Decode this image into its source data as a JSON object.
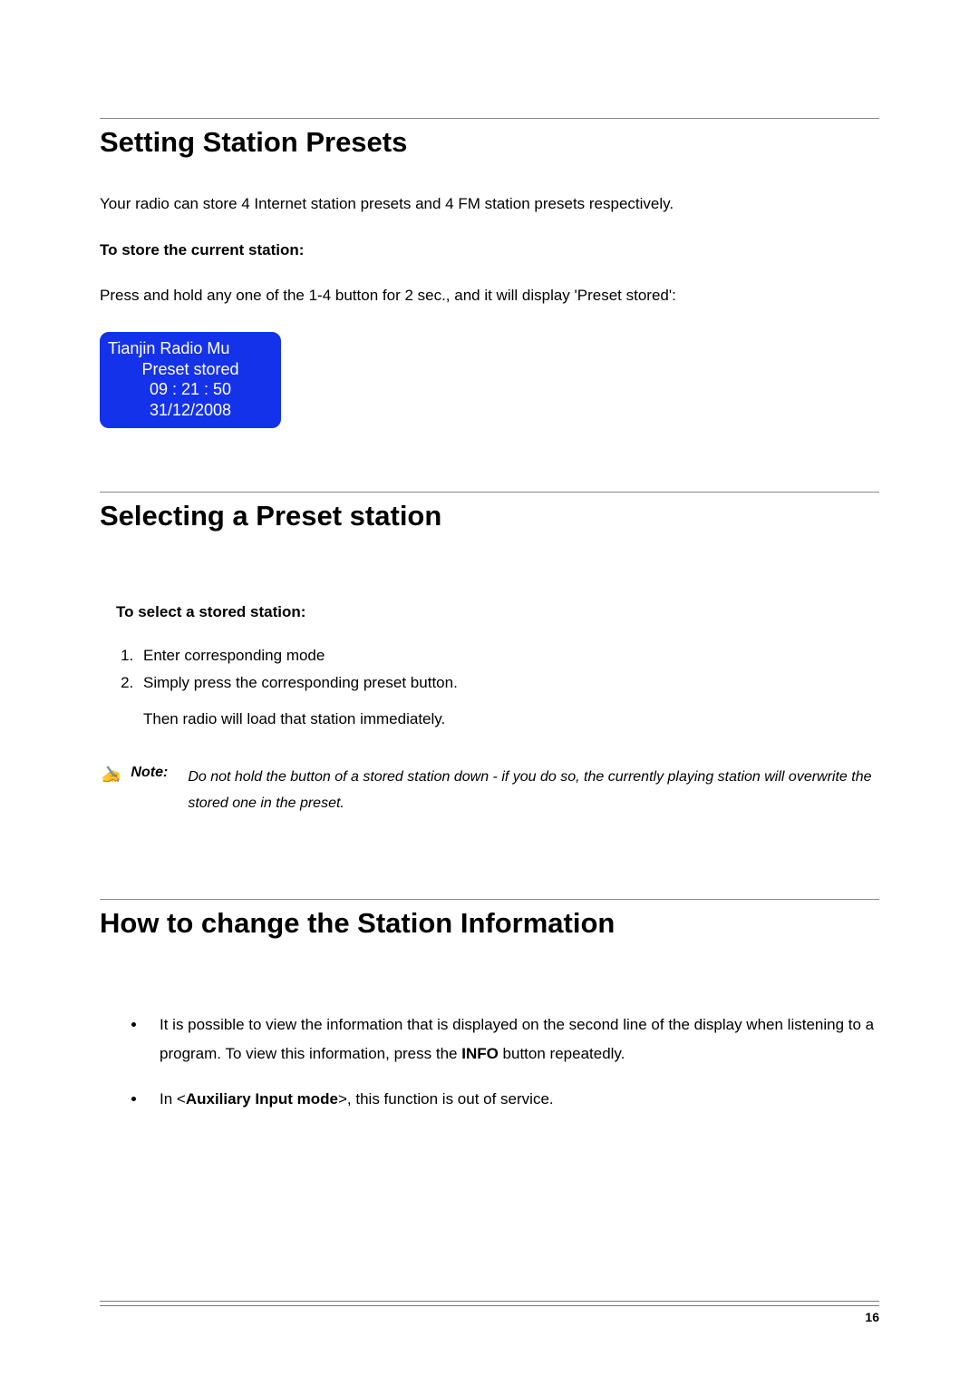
{
  "section1": {
    "title": "Setting Station Presets",
    "intro": "Your radio can store 4 Internet station presets and 4 FM station presets respectively.",
    "store_heading": "To store the current station:",
    "store_instruction": "Press and hold any one of the 1-4 button for 2 sec., and it will display 'Preset stored':",
    "display": {
      "line1": "Tianjin Radio Mu",
      "line2": "Preset stored",
      "line3": "09 : 21 : 50",
      "line4": "31/12/2008"
    }
  },
  "section2": {
    "title": "Selecting a Preset station",
    "select_heading": "To select a stored station:",
    "steps": [
      "Enter corresponding mode",
      "Simply press the corresponding preset button."
    ],
    "step_followup": "Then radio will load that station immediately.",
    "note_label": "Note",
    "note_text": "Do not hold the button of a stored station down - if you do so, the currently playing station will overwrite the stored one in the preset."
  },
  "section3": {
    "title": "How to change the Station Information",
    "bullets": [
      {
        "pre": "It is possible to view the information that is displayed on the second line of the display when listening to a program. To view this information, press the ",
        "bold": "INFO",
        "post": " button repeatedly."
      },
      {
        "pre": "In <",
        "bold": "Auxiliary Input mode",
        "post": ">, this function is out of service."
      }
    ]
  },
  "page_number": "16"
}
